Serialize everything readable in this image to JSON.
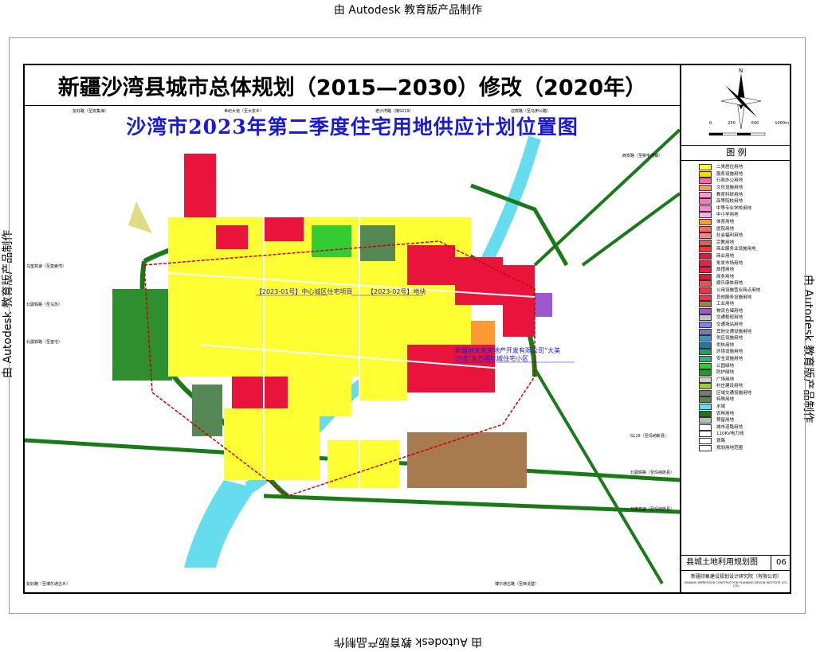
{
  "watermark": "由 Autodesk 教育版产品制作",
  "title": "新疆沙湾县城市总体规划（2015—2030）修改（2020年）",
  "subtitle": "沙湾市2023年第二季度住宅用地供应计划位置图",
  "legend_title": "图    例",
  "scale_labels": [
    "0",
    "250",
    "500",
    "1000m"
  ],
  "north": "N",
  "legend_items": [
    {
      "label": "二类居住用地",
      "color": "#ffff33"
    },
    {
      "label": "服务设施用地",
      "color": "#ffd700"
    },
    {
      "label": "行政办公用地",
      "color": "#ff66aa"
    },
    {
      "label": "文化设施用地",
      "color": "#ff9966"
    },
    {
      "label": "教育科研用地",
      "color": "#ff99cc"
    },
    {
      "label": "高等院校用地",
      "color": "#ff77bb"
    },
    {
      "label": "中等专业学校用地",
      "color": "#ff88cc"
    },
    {
      "label": "中小学用地",
      "color": "#ffaadd"
    },
    {
      "label": "体育用地",
      "color": "#ff9933"
    },
    {
      "label": "医院用地",
      "color": "#ff6666"
    },
    {
      "label": "社会福利用地",
      "color": "#ff8080"
    },
    {
      "label": "宗教用地",
      "color": "#cc6666"
    },
    {
      "label": "商业服务业设施用地",
      "color": "#ff3333"
    },
    {
      "label": "商业用地",
      "color": "#e8143c"
    },
    {
      "label": "批发市场用地",
      "color": "#ee2040"
    },
    {
      "label": "旅馆用地",
      "color": "#e81e4a"
    },
    {
      "label": "商务用地",
      "color": "#d61a3c"
    },
    {
      "label": "娱乐康体用地",
      "color": "#ff4d4d"
    },
    {
      "label": "公用设施营业网点用地",
      "color": "#f03040"
    },
    {
      "label": "其他服务设施用地",
      "color": "#ee3355"
    },
    {
      "label": "工业用地",
      "color": "#a87a50"
    },
    {
      "label": "物流仓储用地",
      "color": "#9b59d0"
    },
    {
      "label": "交通枢纽用地",
      "color": "#c0c0c0"
    },
    {
      "label": "交通场站用地",
      "color": "#8080ff"
    },
    {
      "label": "其他交通设施用地",
      "color": "#7a7aa8"
    },
    {
      "label": "供应设施用地",
      "color": "#3399cc"
    },
    {
      "label": "供热用地",
      "color": "#2277aa"
    },
    {
      "label": "环境设施用地",
      "color": "#339966"
    },
    {
      "label": "安全设施用地",
      "color": "#44aa77"
    },
    {
      "label": "公园绿地",
      "color": "#33cc33"
    },
    {
      "label": "防护绿地",
      "color": "#229922"
    },
    {
      "label": "广场用地",
      "color": "#cccccc"
    },
    {
      "label": "村庄建设用地",
      "color": "#99cc33"
    },
    {
      "label": "区域交通设施用地",
      "color": "#777777"
    },
    {
      "label": "特殊用地",
      "color": "#558855"
    },
    {
      "label": "水域",
      "color": "#66ddee"
    },
    {
      "label": "农林用地",
      "color": "#1a7a1a"
    },
    {
      "label": "预留用地",
      "color": "#bbbbbb"
    },
    {
      "label": "城市道路用地",
      "color": "#ffffff"
    },
    {
      "label": "110KV电力线",
      "color": "#ffffff"
    },
    {
      "label": "铁路",
      "color": "#ffffff"
    },
    {
      "label": "规划用地范围",
      "color": "#ffffff"
    }
  ],
  "sheet_name": "县城土地利用规划图",
  "sheet_number": "06",
  "institute": "新疆印象建设规划设计研究院（有限公司）",
  "institute_en": "XINJIANG IMPRESSION CONSTRUCTION PLANNING DESIGN INSTITUTE (CO., LTD)",
  "road_labels": [
    "友好路（至安集海）",
    "世纪大道（至大泉乡）",
    "老沙湾路（接S219）",
    "迎宾路（至乌伊公路）",
    "西安路（至柳毛湾镇）",
    "乌奎高速（至莫索湾）",
    "北疆铁路（至乌苏）",
    "北疆铁路（至奎屯）",
    "S115（至玛纳斯县）",
    "北疆铁路（至玛纳斯县）",
    "乌奎高速（至玛纳斯县）",
    "友好路（至博尔通古乡）",
    "博尔通古路（至西戈壁）"
  ],
  "annotations": {
    "site1": "【2023-01号】中心城区住宅项目",
    "site2": "【2023-02号】地块",
    "site3_line1": "新疆创未来房地产开发有限公司“大美",
    "site3_line2": "沙湾”东方国际城住宅小区"
  }
}
